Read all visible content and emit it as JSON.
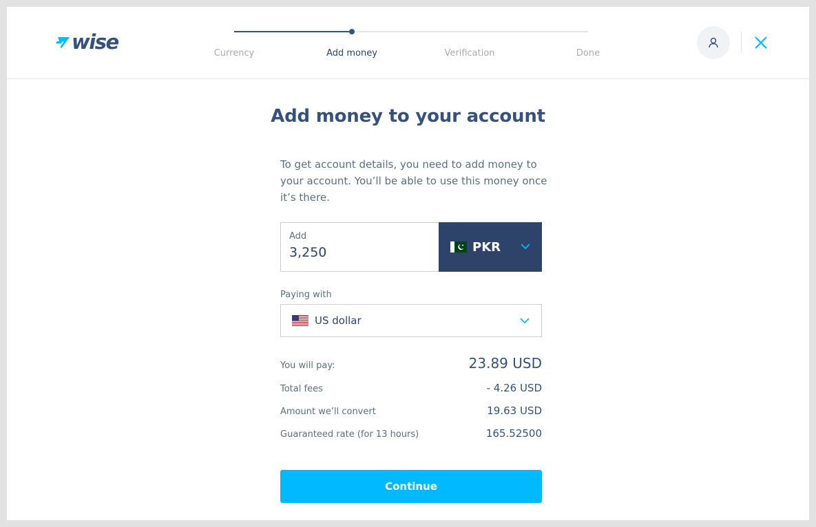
{
  "header": {
    "logo_text": "wise",
    "steps": [
      {
        "label": "Currency",
        "state": "done"
      },
      {
        "label": "Add money",
        "state": "active"
      },
      {
        "label": "Verification",
        "state": "pending"
      },
      {
        "label": "Done",
        "state": "pending"
      }
    ],
    "progress": 0.33,
    "avatar_icon": "user-icon",
    "close_icon": "close-icon"
  },
  "main": {
    "title": "Add money to your account",
    "description": "To get account details, you need to add money to your account. You’ll be able to use this money once it’s there.",
    "amount": {
      "label": "Add",
      "value": "3,250",
      "currency": "PKR",
      "currency_flag": "pakistan-flag-icon"
    },
    "paying_with": {
      "label": "Paying with",
      "value": "US dollar",
      "flag": "us-flag-icon"
    },
    "summary": {
      "you_will_pay_label": "You will pay:",
      "you_will_pay_value": "23.89 USD",
      "fees_label": "Total fees",
      "fees_value": "- 4.26 USD",
      "convert_label": "Amount we’ll convert",
      "convert_value": "19.63 USD",
      "rate_label": "Guaranteed rate (for 13 hours)",
      "rate_value": "165.52500"
    },
    "continue_label": "Continue"
  },
  "colors": {
    "brand_navy": "#37517e",
    "accent_blue": "#00b9ff",
    "pk_green": "#01411c"
  }
}
